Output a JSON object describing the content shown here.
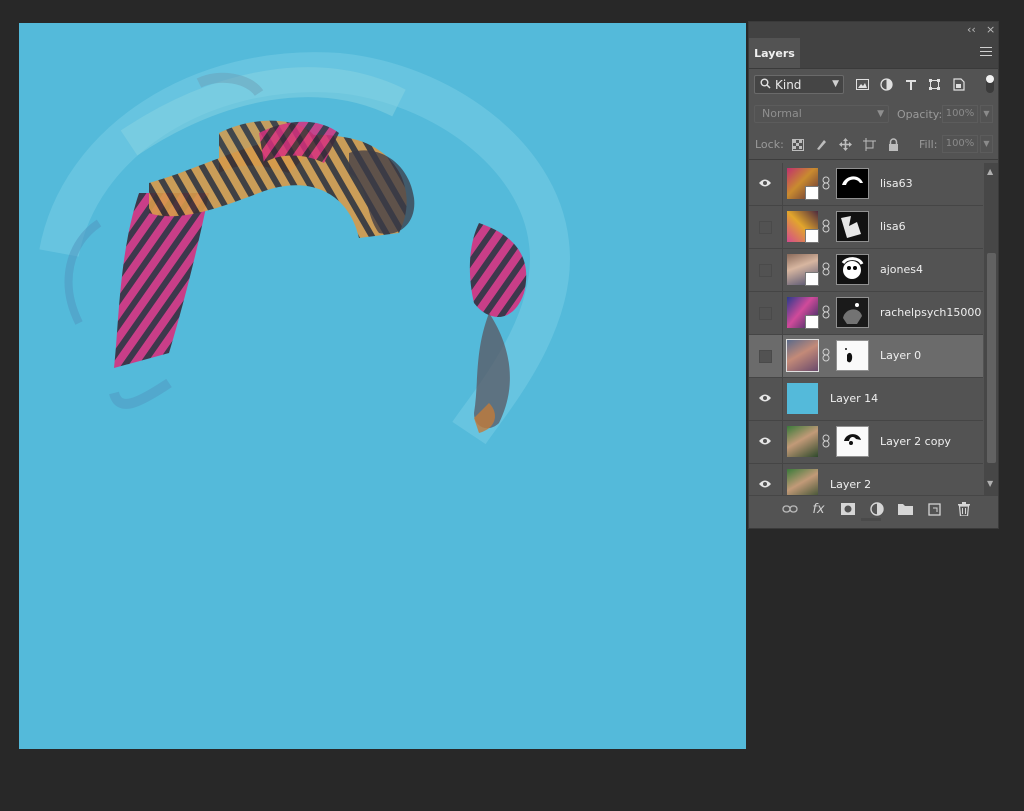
{
  "canvas": {
    "background_color": "#54bada"
  },
  "panel": {
    "collapse_label": "‹‹",
    "close_label": "×",
    "tab_label": "Layers",
    "filter": {
      "kind_label": "Kind",
      "icons": [
        "image-filter-icon",
        "adjustment-filter-icon",
        "type-filter-icon",
        "shape-filter-icon",
        "smart-object-filter-icon"
      ]
    },
    "blend_mode": "Normal",
    "opacity_label": "Opacity:",
    "opacity_value": "100%",
    "lock_label": "Lock:",
    "fill_label": "Fill:",
    "fill_value": "100%",
    "layers": [
      {
        "name": "lisa63",
        "visible": true,
        "has_mask": true,
        "selected": false
      },
      {
        "name": "lisa6",
        "visible": false,
        "has_mask": true,
        "selected": false
      },
      {
        "name": "ajones4",
        "visible": false,
        "has_mask": true,
        "selected": false
      },
      {
        "name": "rachelpsych15000",
        "visible": false,
        "has_mask": true,
        "selected": false
      },
      {
        "name": "Layer 0",
        "visible": false,
        "has_mask": true,
        "selected": true
      },
      {
        "name": "Layer 14",
        "visible": true,
        "has_mask": false,
        "selected": false
      },
      {
        "name": "Layer 2 copy",
        "visible": true,
        "has_mask": true,
        "selected": false
      },
      {
        "name": "Layer 2",
        "visible": true,
        "has_mask": false,
        "selected": false
      }
    ],
    "bottom_icons": [
      "link-layers-icon",
      "fx-icon",
      "add-mask-icon",
      "adjustment-layer-icon",
      "new-group-icon",
      "new-layer-icon",
      "trash-icon"
    ],
    "fx_label": "fx"
  }
}
